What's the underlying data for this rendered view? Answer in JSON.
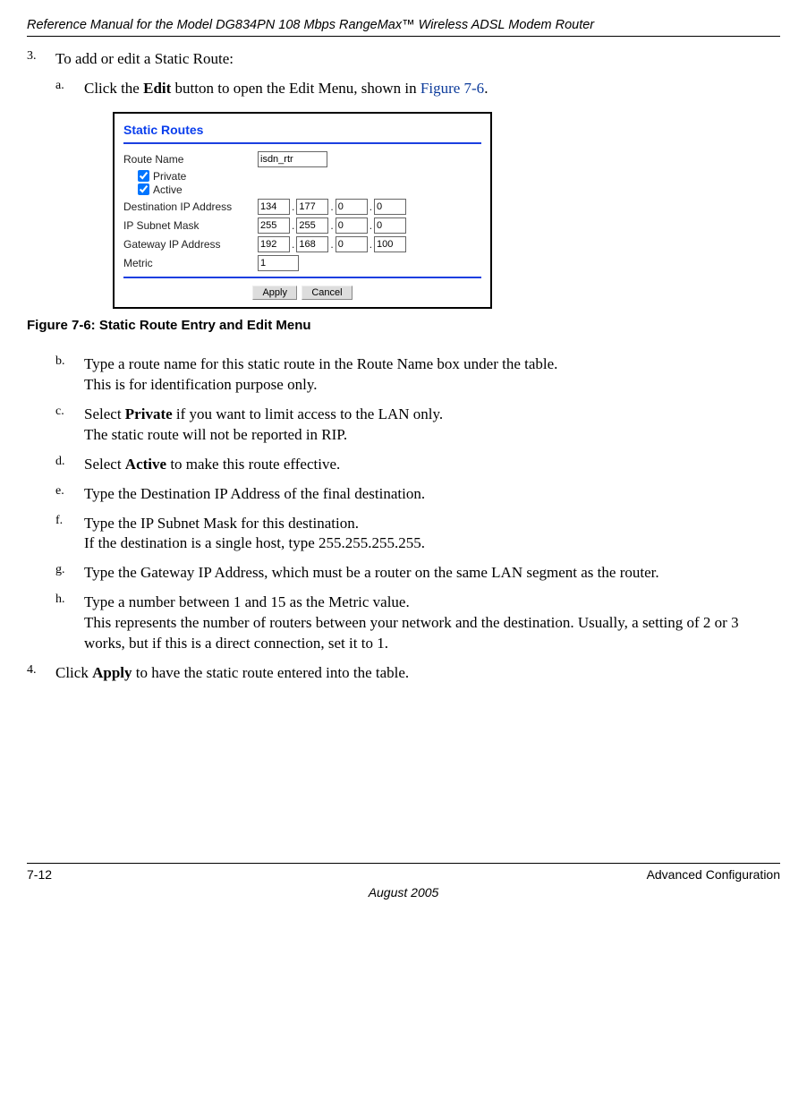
{
  "running_header": "Reference Manual for the Model DG834PN 108 Mbps RangeMax™ Wireless ADSL Modem Router",
  "step3": {
    "marker": "3.",
    "text": "To add or edit a Static Route:"
  },
  "a": {
    "marker": "a.",
    "pre": "Click the ",
    "bold": "Edit",
    "mid": " button to open the Edit Menu, shown in ",
    "link": "Figure 7-6",
    "post": "."
  },
  "panel": {
    "title": "Static Routes",
    "route_name_label": "Route Name",
    "route_name_value": "isdn_rtr",
    "private_label": "Private",
    "active_label": "Active",
    "dest_label": "Destination IP Address",
    "dest": [
      "134",
      "177",
      "0",
      "0"
    ],
    "mask_label": "IP Subnet Mask",
    "mask": [
      "255",
      "255",
      "0",
      "0"
    ],
    "gw_label": "Gateway IP Address",
    "gw": [
      "192",
      "168",
      "0",
      "100"
    ],
    "metric_label": "Metric",
    "metric_value": "1",
    "apply": "Apply",
    "cancel": "Cancel"
  },
  "figure_caption": "Figure 7-6:  Static Route Entry and Edit Menu",
  "b": {
    "marker": "b.",
    "l1": "Type a route name for this static route in the Route Name box under the table.",
    "l2": "This is for identification purpose only."
  },
  "c": {
    "marker": "c.",
    "pre": "Select ",
    "bold": "Private",
    "post": " if you want to limit access to the LAN only.",
    "l2": "The static route will not be reported in RIP."
  },
  "d": {
    "marker": "d.",
    "pre": "Select ",
    "bold": "Active",
    "post": " to make this route effective."
  },
  "e": {
    "marker": "e.",
    "text": "Type the Destination IP Address of the final destination."
  },
  "f": {
    "marker": "f.",
    "l1": "Type the IP Subnet Mask for this destination.",
    "l2": "If the destination is a single host, type 255.255.255.255."
  },
  "g": {
    "marker": "g.",
    "text": "Type the Gateway IP Address, which must be a router on the same LAN segment as the router."
  },
  "h": {
    "marker": "h.",
    "l1": "Type a number between 1 and 15 as the Metric value.",
    "l2": "This represents the number of routers between your network and the destination. Usually, a setting of 2 or 3 works, but if this is a direct connection, set it to 1."
  },
  "step4": {
    "marker": "4.",
    "pre": "Click ",
    "bold": "Apply",
    "post": " to have the static route entered into the table."
  },
  "footer_left": "7-12",
  "footer_right": "Advanced Configuration",
  "footer_date": "August 2005"
}
